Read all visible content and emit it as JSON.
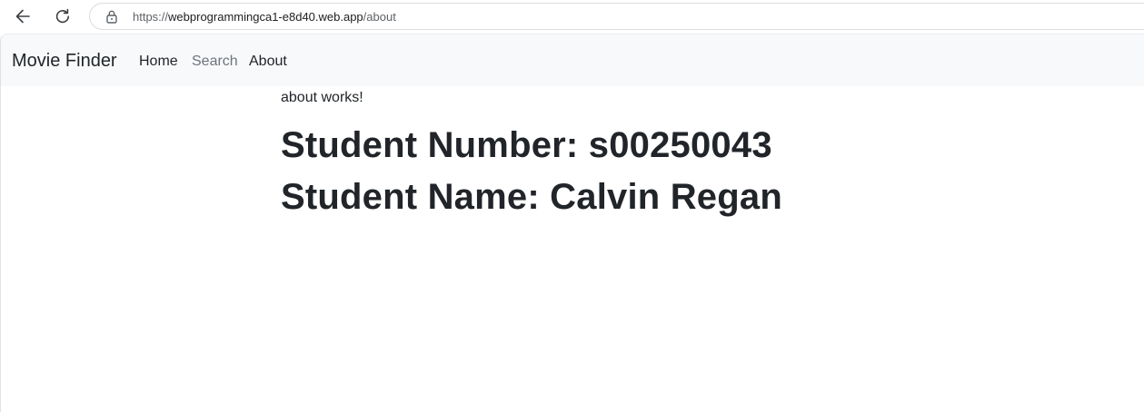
{
  "browser": {
    "url_scheme": "https://",
    "url_host": "webprogrammingca1-e8d40.web.app",
    "url_path": "/about",
    "icons": {
      "back": "back-arrow-icon",
      "reload": "reload-icon",
      "site_info": "lock-icon"
    }
  },
  "navbar": {
    "brand": "Movie Finder",
    "links": [
      {
        "label": "Home"
      },
      {
        "label": "Search"
      },
      {
        "label": "About"
      }
    ]
  },
  "main": {
    "about_text": "about works!",
    "student_number": "Student Number: s00250043",
    "student_name": "Student Name: Calvin Regan"
  },
  "colors": {
    "navbar_bg": "#f8f9fa",
    "text": "#212529",
    "muted_link": "#6c757d"
  }
}
